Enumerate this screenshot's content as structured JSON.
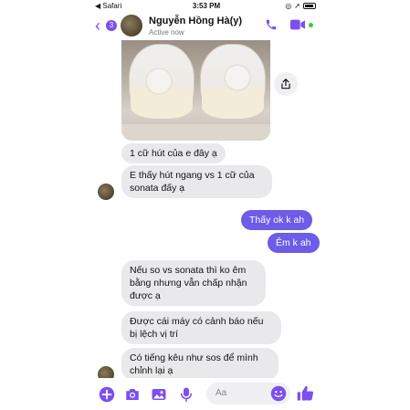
{
  "statusbar": {
    "back_app": "◀ Safari",
    "time": "3:53 PM"
  },
  "header": {
    "unread_count": "3",
    "contact_name": "Nguyễn Hồng Hà(y)",
    "status": "Active now",
    "accent": "#7b4ff0"
  },
  "messages": [
    {
      "from": "them",
      "text": "1 cữ hút của e đây ạ"
    },
    {
      "from": "them",
      "text": "E thấy hút ngang vs 1 cữ của sonata đấy ạ"
    },
    {
      "from": "me",
      "text": "Thấy ok k ah"
    },
    {
      "from": "me",
      "text": "Êm k ah"
    },
    {
      "from": "them",
      "text": "Nếu so vs sonata thì ko êm bằng nhưng vẫn chấp nhận được ạ"
    },
    {
      "from": "them",
      "text": "Được cái máy có cảnh báo nếu bị lệch vị trí"
    },
    {
      "from": "them",
      "text": "Có tiếng kêu như sos để mình chỉnh lại ạ"
    }
  ],
  "composer": {
    "placeholder": "Aa"
  },
  "icons": [
    "back-arrow-icon",
    "phone-icon",
    "video-camera-icon",
    "share-icon",
    "plus-icon",
    "camera-icon",
    "photo-icon",
    "microphone-icon",
    "emoji-icon",
    "thumbs-up-icon"
  ]
}
